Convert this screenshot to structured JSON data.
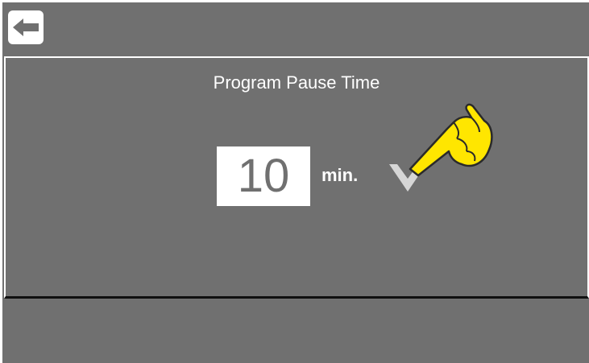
{
  "header": {
    "back_icon": "left-arrow-icon"
  },
  "panel": {
    "title": "Program Pause Time",
    "value": "10",
    "unit": "min.",
    "confirm_icon": "checkmark-chevron-icon",
    "pointer_icon": "pointing-hand-icon"
  },
  "colors": {
    "background": "#707070",
    "panel_border": "#ffffff",
    "divider": "#101010",
    "hand_fill": "#ffe600",
    "checkmark": "#d6d6d6"
  }
}
